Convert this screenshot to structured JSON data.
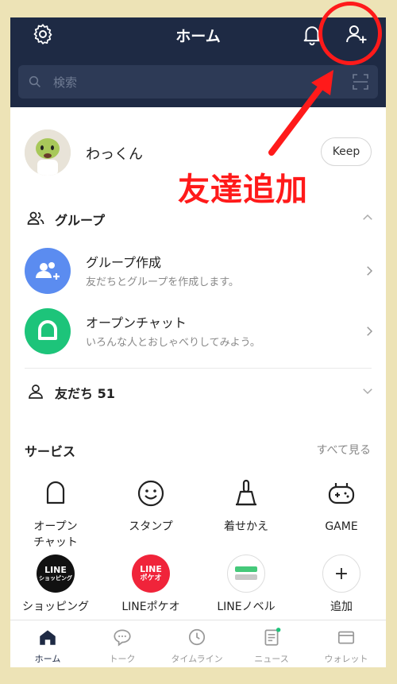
{
  "header": {
    "title": "ホーム",
    "search_placeholder": "検索"
  },
  "profile": {
    "name": "わっくん",
    "keep_label": "Keep"
  },
  "group_section": {
    "label": "グループ"
  },
  "rows": [
    {
      "title": "グループ作成",
      "subtitle": "友だちとグループを作成します。"
    },
    {
      "title": "オープンチャット",
      "subtitle": "いろんな人とおしゃべりしてみよう。"
    }
  ],
  "friends_section": {
    "label": "友だち 51"
  },
  "services": {
    "title": "サービス",
    "see_all": "すべて見る",
    "items": [
      {
        "label": "オープン\nチャット",
        "icon": "openchat-icon"
      },
      {
        "label": "スタンプ",
        "icon": "smiley-icon"
      },
      {
        "label": "着せかえ",
        "icon": "brush-icon"
      },
      {
        "label": "GAME",
        "icon": "gamepad-icon"
      },
      {
        "label": "ショッピング",
        "icon": "line-shopping-icon",
        "badge": "LINE\nショッピング"
      },
      {
        "label": "LINEポケオ",
        "icon": "line-pokeo-icon",
        "badge": "LINE\nポケオ"
      },
      {
        "label": "LINEノベル",
        "icon": "line-novel-icon"
      },
      {
        "label": "追加",
        "icon": "plus-icon"
      }
    ]
  },
  "tabs": [
    {
      "label": "ホーム",
      "icon": "home-icon",
      "active": true
    },
    {
      "label": "トーク",
      "icon": "chat-icon"
    },
    {
      "label": "タイムライン",
      "icon": "clock-icon"
    },
    {
      "label": "ニュース",
      "icon": "news-icon"
    },
    {
      "label": "ウォレット",
      "icon": "wallet-icon"
    }
  ],
  "annotation": {
    "text": "友達追加"
  },
  "colors": {
    "header": "#1e2a44",
    "accent_red": "#ff1a1a",
    "group_blue": "#5b8cf0",
    "openchat_green": "#1dc47a"
  }
}
